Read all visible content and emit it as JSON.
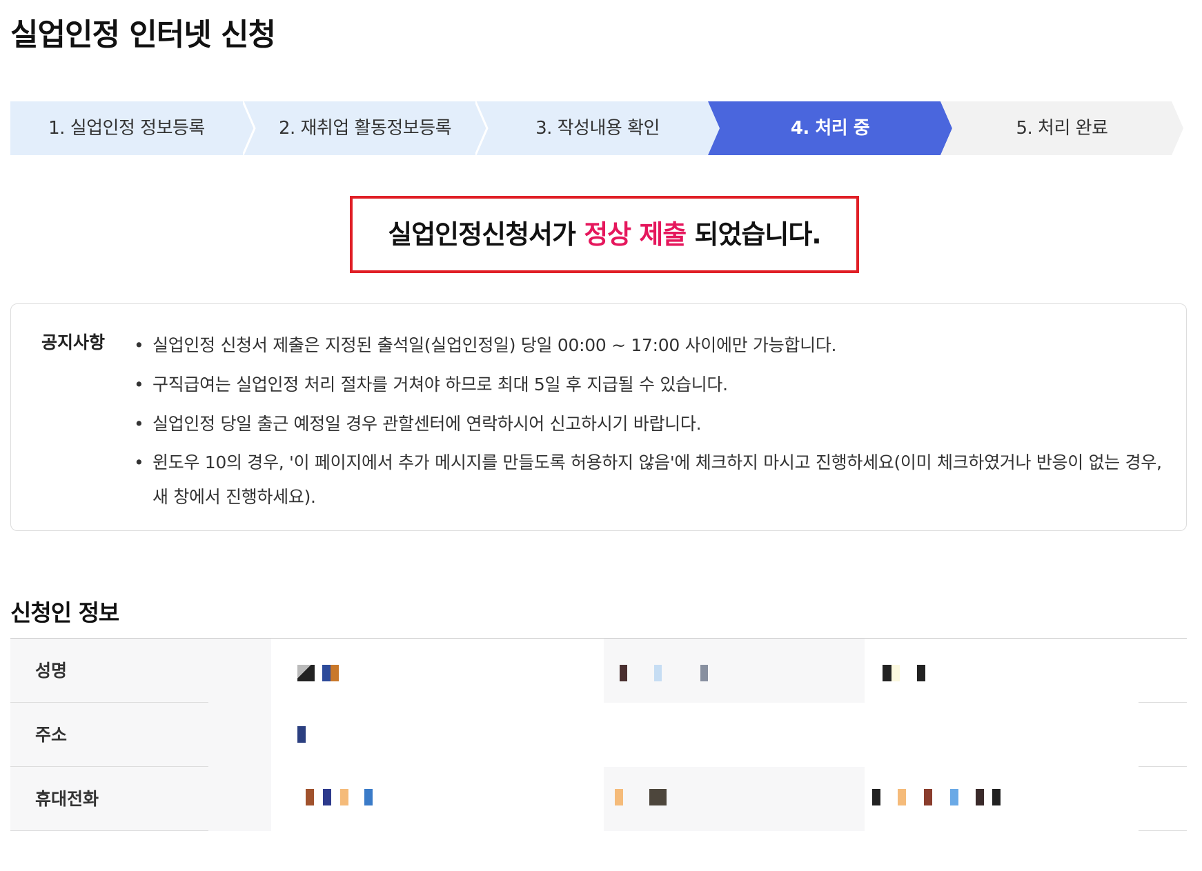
{
  "page": {
    "title": "실업인정 인터넷 신청"
  },
  "stepper": {
    "steps": [
      {
        "label": "1. 실업인정 정보등록",
        "state": "done"
      },
      {
        "label": "2. 재취업 활동정보등록",
        "state": "done"
      },
      {
        "label": "3. 작성내용 확인",
        "state": "done"
      },
      {
        "label": "4. 처리 중",
        "state": "active"
      },
      {
        "label": "5. 처리 완료",
        "state": "pending"
      }
    ],
    "colors": {
      "done": "#e3eefb",
      "active": "#4a66dd",
      "pending": "#f2f2f2"
    }
  },
  "result": {
    "prefix": "실업인정신청서가 ",
    "highlight": "정상 제출",
    "suffix": " 되었습니다.",
    "border_color": "#e01f26",
    "highlight_color": "#e5175c"
  },
  "notice": {
    "title": "공지사항",
    "bullet": "•",
    "items": [
      "실업인정 신청서 제출은 지정된 출석일(실업인정일) 당일 00:00 ~ 17:00 사이에만 가능합니다.",
      "구직급여는 실업인정 처리 절차를 거쳐야 하므로 최대 5일 후 지급될 수 있습니다.",
      "실업인정 당일 출근 예정일 경우 관할센터에 연락하시어 신고하시기 바랍니다.",
      "윈도우 10의 경우, '이 페이지에서 추가 메시지를 만들도록 허용하지 않음'에 체크하지 마시고 진행하세요(이미 체크하였거나 반응이 없는 경우, 새 창에서 진행하세요)."
    ]
  },
  "applicant": {
    "section_title": "신청인 정보",
    "rows": [
      {
        "label": "성명"
      },
      {
        "label": "주소"
      },
      {
        "label": "휴대전화"
      }
    ]
  }
}
